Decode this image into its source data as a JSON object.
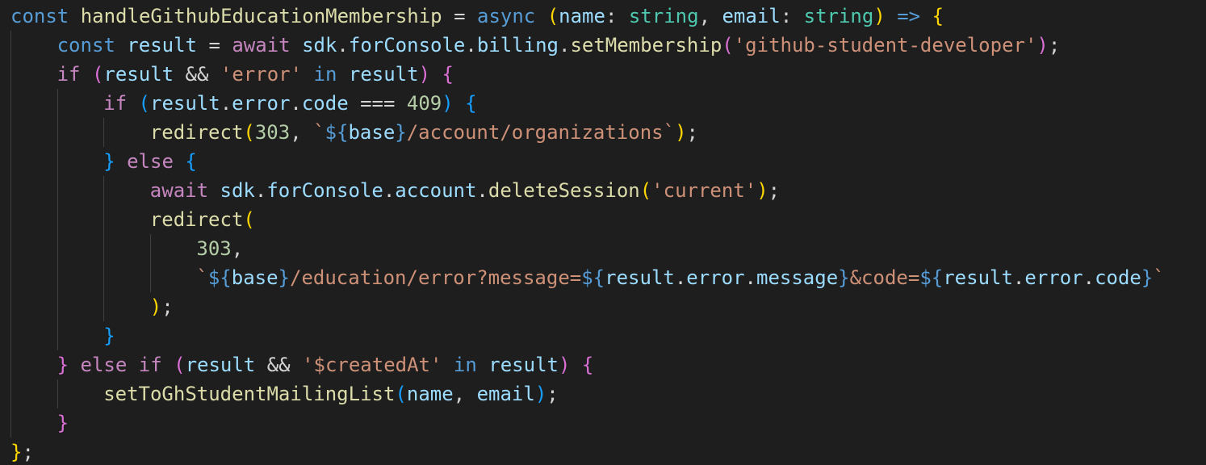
{
  "editor": {
    "colors": {
      "background": "#1e1e1e",
      "keyword": "#569cd6",
      "control": "#c586c0",
      "function": "#dcdcaa",
      "variable": "#9cdcfe",
      "type": "#4ec9b0",
      "string": "#ce9178",
      "number": "#b5cea8",
      "punct": "#d4d4d4",
      "brace1": "#ffd700",
      "brace2": "#da70d6",
      "brace3": "#179fff",
      "indent_guide": "#404040"
    },
    "lines": [
      {
        "indent": 0,
        "tokens": [
          {
            "t": "const",
            "c": "keyword"
          },
          {
            "t": " ",
            "c": "punct"
          },
          {
            "t": "handleGithubEducationMembership",
            "c": "function"
          },
          {
            "t": " = ",
            "c": "punct"
          },
          {
            "t": "async",
            "c": "keyword"
          },
          {
            "t": " ",
            "c": "punct"
          },
          {
            "t": "(",
            "c": "brace1"
          },
          {
            "t": "name",
            "c": "variable"
          },
          {
            "t": ": ",
            "c": "punct"
          },
          {
            "t": "string",
            "c": "type"
          },
          {
            "t": ", ",
            "c": "punct"
          },
          {
            "t": "email",
            "c": "variable"
          },
          {
            "t": ": ",
            "c": "punct"
          },
          {
            "t": "string",
            "c": "type"
          },
          {
            "t": ")",
            "c": "brace1"
          },
          {
            "t": " ",
            "c": "punct"
          },
          {
            "t": "=>",
            "c": "keyword"
          },
          {
            "t": " ",
            "c": "punct"
          },
          {
            "t": "{",
            "c": "brace1"
          }
        ]
      },
      {
        "indent": 1,
        "tokens": [
          {
            "t": "const",
            "c": "keyword"
          },
          {
            "t": " ",
            "c": "punct"
          },
          {
            "t": "result",
            "c": "variable"
          },
          {
            "t": " = ",
            "c": "punct"
          },
          {
            "t": "await",
            "c": "control"
          },
          {
            "t": " ",
            "c": "punct"
          },
          {
            "t": "sdk",
            "c": "variable"
          },
          {
            "t": ".",
            "c": "punct"
          },
          {
            "t": "forConsole",
            "c": "variable"
          },
          {
            "t": ".",
            "c": "punct"
          },
          {
            "t": "billing",
            "c": "variable"
          },
          {
            "t": ".",
            "c": "punct"
          },
          {
            "t": "setMembership",
            "c": "function"
          },
          {
            "t": "(",
            "c": "brace2"
          },
          {
            "t": "'github-student-developer'",
            "c": "string"
          },
          {
            "t": ")",
            "c": "brace2"
          },
          {
            "t": ";",
            "c": "punct"
          }
        ]
      },
      {
        "indent": 1,
        "tokens": [
          {
            "t": "if",
            "c": "control"
          },
          {
            "t": " ",
            "c": "punct"
          },
          {
            "t": "(",
            "c": "brace2"
          },
          {
            "t": "result",
            "c": "variable"
          },
          {
            "t": " && ",
            "c": "punct"
          },
          {
            "t": "'error'",
            "c": "string"
          },
          {
            "t": " ",
            "c": "punct"
          },
          {
            "t": "in",
            "c": "keyword"
          },
          {
            "t": " ",
            "c": "punct"
          },
          {
            "t": "result",
            "c": "variable"
          },
          {
            "t": ")",
            "c": "brace2"
          },
          {
            "t": " ",
            "c": "punct"
          },
          {
            "t": "{",
            "c": "brace2"
          }
        ]
      },
      {
        "indent": 2,
        "tokens": [
          {
            "t": "if",
            "c": "control"
          },
          {
            "t": " ",
            "c": "punct"
          },
          {
            "t": "(",
            "c": "brace3"
          },
          {
            "t": "result",
            "c": "variable"
          },
          {
            "t": ".",
            "c": "punct"
          },
          {
            "t": "error",
            "c": "variable"
          },
          {
            "t": ".",
            "c": "punct"
          },
          {
            "t": "code",
            "c": "variable"
          },
          {
            "t": " === ",
            "c": "punct"
          },
          {
            "t": "409",
            "c": "number"
          },
          {
            "t": ")",
            "c": "brace3"
          },
          {
            "t": " ",
            "c": "punct"
          },
          {
            "t": "{",
            "c": "brace3"
          }
        ]
      },
      {
        "indent": 3,
        "tokens": [
          {
            "t": "redirect",
            "c": "function"
          },
          {
            "t": "(",
            "c": "brace1"
          },
          {
            "t": "303",
            "c": "number"
          },
          {
            "t": ", ",
            "c": "punct"
          },
          {
            "t": "`",
            "c": "string"
          },
          {
            "t": "${",
            "c": "keyword"
          },
          {
            "t": "base",
            "c": "variable"
          },
          {
            "t": "}",
            "c": "keyword"
          },
          {
            "t": "/account/organizations`",
            "c": "string"
          },
          {
            "t": ")",
            "c": "brace1"
          },
          {
            "t": ";",
            "c": "punct"
          }
        ]
      },
      {
        "indent": 2,
        "tokens": [
          {
            "t": "}",
            "c": "brace3"
          },
          {
            "t": " ",
            "c": "punct"
          },
          {
            "t": "else",
            "c": "control"
          },
          {
            "t": " ",
            "c": "punct"
          },
          {
            "t": "{",
            "c": "brace3"
          }
        ]
      },
      {
        "indent": 3,
        "tokens": [
          {
            "t": "await",
            "c": "control"
          },
          {
            "t": " ",
            "c": "punct"
          },
          {
            "t": "sdk",
            "c": "variable"
          },
          {
            "t": ".",
            "c": "punct"
          },
          {
            "t": "forConsole",
            "c": "variable"
          },
          {
            "t": ".",
            "c": "punct"
          },
          {
            "t": "account",
            "c": "variable"
          },
          {
            "t": ".",
            "c": "punct"
          },
          {
            "t": "deleteSession",
            "c": "function"
          },
          {
            "t": "(",
            "c": "brace1"
          },
          {
            "t": "'current'",
            "c": "string"
          },
          {
            "t": ")",
            "c": "brace1"
          },
          {
            "t": ";",
            "c": "punct"
          }
        ]
      },
      {
        "indent": 3,
        "tokens": [
          {
            "t": "redirect",
            "c": "function"
          },
          {
            "t": "(",
            "c": "brace1"
          }
        ]
      },
      {
        "indent": 4,
        "tokens": [
          {
            "t": "303",
            "c": "number"
          },
          {
            "t": ",",
            "c": "punct"
          }
        ]
      },
      {
        "indent": 4,
        "tokens": [
          {
            "t": "`",
            "c": "string"
          },
          {
            "t": "${",
            "c": "keyword"
          },
          {
            "t": "base",
            "c": "variable"
          },
          {
            "t": "}",
            "c": "keyword"
          },
          {
            "t": "/education/error?message=",
            "c": "string"
          },
          {
            "t": "${",
            "c": "keyword"
          },
          {
            "t": "result",
            "c": "variable"
          },
          {
            "t": ".",
            "c": "punct"
          },
          {
            "t": "error",
            "c": "variable"
          },
          {
            "t": ".",
            "c": "punct"
          },
          {
            "t": "message",
            "c": "variable"
          },
          {
            "t": "}",
            "c": "keyword"
          },
          {
            "t": "&code=",
            "c": "string"
          },
          {
            "t": "${",
            "c": "keyword"
          },
          {
            "t": "result",
            "c": "variable"
          },
          {
            "t": ".",
            "c": "punct"
          },
          {
            "t": "error",
            "c": "variable"
          },
          {
            "t": ".",
            "c": "punct"
          },
          {
            "t": "code",
            "c": "variable"
          },
          {
            "t": "}",
            "c": "keyword"
          },
          {
            "t": "`",
            "c": "string"
          }
        ]
      },
      {
        "indent": 3,
        "tokens": [
          {
            "t": ")",
            "c": "brace1"
          },
          {
            "t": ";",
            "c": "punct"
          }
        ]
      },
      {
        "indent": 2,
        "tokens": [
          {
            "t": "}",
            "c": "brace3"
          }
        ]
      },
      {
        "indent": 1,
        "tokens": [
          {
            "t": "}",
            "c": "brace2"
          },
          {
            "t": " ",
            "c": "punct"
          },
          {
            "t": "else",
            "c": "control"
          },
          {
            "t": " ",
            "c": "punct"
          },
          {
            "t": "if",
            "c": "control"
          },
          {
            "t": " ",
            "c": "punct"
          },
          {
            "t": "(",
            "c": "brace2"
          },
          {
            "t": "result",
            "c": "variable"
          },
          {
            "t": " && ",
            "c": "punct"
          },
          {
            "t": "'$createdAt'",
            "c": "string"
          },
          {
            "t": " ",
            "c": "punct"
          },
          {
            "t": "in",
            "c": "keyword"
          },
          {
            "t": " ",
            "c": "punct"
          },
          {
            "t": "result",
            "c": "variable"
          },
          {
            "t": ")",
            "c": "brace2"
          },
          {
            "t": " ",
            "c": "punct"
          },
          {
            "t": "{",
            "c": "brace2"
          }
        ]
      },
      {
        "indent": 2,
        "tokens": [
          {
            "t": "setToGhStudentMailingList",
            "c": "function"
          },
          {
            "t": "(",
            "c": "brace3"
          },
          {
            "t": "name",
            "c": "variable"
          },
          {
            "t": ", ",
            "c": "punct"
          },
          {
            "t": "email",
            "c": "variable"
          },
          {
            "t": ")",
            "c": "brace3"
          },
          {
            "t": ";",
            "c": "punct"
          }
        ]
      },
      {
        "indent": 1,
        "tokens": [
          {
            "t": "}",
            "c": "brace2"
          }
        ]
      },
      {
        "indent": 0,
        "tokens": [
          {
            "t": "}",
            "c": "brace1"
          },
          {
            "t": ";",
            "c": "punct"
          }
        ]
      }
    ]
  }
}
